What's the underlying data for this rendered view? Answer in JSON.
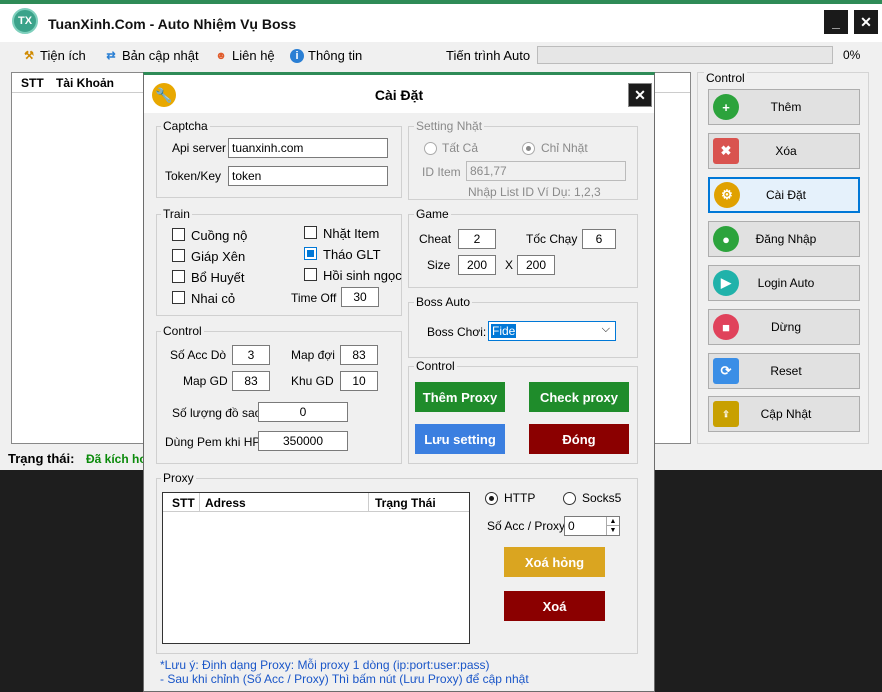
{
  "app": {
    "logo": "TX",
    "title": "TuanXinh.Com - Auto Nhiệm Vụ Boss",
    "minimize": "_",
    "close": "✕"
  },
  "menu": [
    {
      "label": "Tiện ích",
      "icon": "tools-icon"
    },
    {
      "label": "Bản cập nhật",
      "icon": "refresh-icon"
    },
    {
      "label": "Liên hệ",
      "icon": "person-icon"
    },
    {
      "label": "Thông tin",
      "icon": "info-icon"
    }
  ],
  "progress": {
    "label": "Tiến trình Auto",
    "value_text": "0%",
    "fraction": 0
  },
  "accounts": {
    "columns": [
      "STT",
      "Tài Khoản"
    ]
  },
  "status": {
    "label": "Trạng thái:",
    "value": "Đã kích ho"
  },
  "right_panel": {
    "legend": "Control",
    "buttons": [
      {
        "label": "Thêm",
        "icon": "plus-icon",
        "color": "#2ca33c"
      },
      {
        "label": "Xóa",
        "icon": "trash-icon",
        "color": "#d9534f"
      },
      {
        "label": "Cài Đặt",
        "icon": "gear-icon",
        "color": "#e0a100"
      },
      {
        "label": "Đăng Nhập",
        "icon": "login-icon",
        "color": "#2ca33c"
      },
      {
        "label": "Login Auto",
        "icon": "play-icon",
        "color": "#20b2aa"
      },
      {
        "label": "Dừng",
        "icon": "stop-icon",
        "color": "#e0425b"
      },
      {
        "label": "Reset",
        "icon": "reset-icon",
        "color": "#3a8ee6"
      },
      {
        "label": "Cập Nhật",
        "icon": "update-icon",
        "color": "#c8a000"
      }
    ]
  },
  "dialog": {
    "title": "Cài Đặt",
    "close": "✕",
    "captcha": {
      "legend": "Captcha",
      "api_label": "Api server",
      "api_value": "tuanxinh.com",
      "token_label": "Token/Key",
      "token_value": "token"
    },
    "setting_nhat": {
      "legend": "Setting Nhặt",
      "all": "Tất Cả",
      "only": "Chỉ Nhặt",
      "id_label": "ID Item",
      "id_value": "861,77",
      "hint": "Nhập List ID Ví Dụ: 1,2,3"
    },
    "train": {
      "legend": "Train",
      "items": [
        "Cuồng nộ",
        "Giáp Xên",
        "Bổ Huyết",
        "Nhai cỏ"
      ],
      "items_right": [
        "Nhặt Item",
        "Tháo GLT",
        "Hồi sinh ngọc"
      ],
      "timeoff_label": "Time Off",
      "timeoff_value": "30"
    },
    "game": {
      "legend": "Game",
      "cheat_label": "Cheat",
      "cheat_value": "2",
      "speed_label": "Tốc Chạy",
      "speed_value": "6",
      "size_label": "Size",
      "w": "200",
      "x": "X",
      "h": "200"
    },
    "boss": {
      "legend": "Boss Auto",
      "label": "Boss Chơi:",
      "value": "Fide",
      "arrow": "⌵"
    },
    "control": {
      "legend": "Control",
      "acc_label": "Số Acc Dò",
      "acc_value": "3",
      "mapdoi_label": "Map đợi",
      "mapdoi_value": "83",
      "mapgd_label": "Map GD",
      "mapgd_value": "83",
      "khugd_label": "Khu GD",
      "khugd_value": "10",
      "sao_label": "Số lượng đồ sao",
      "sao_value": "0",
      "pem_label": "Dùng Pem khi HP",
      "pem_value": "350000"
    },
    "control2": {
      "legend": "Control",
      "add_proxy": "Thêm Proxy",
      "check_proxy": "Check proxy",
      "save": "Lưu setting",
      "close": "Đóng",
      "colors": {
        "green": "#1f8c2b",
        "blue": "#3b7fe0",
        "red": "#8b0000"
      }
    },
    "proxy": {
      "legend": "Proxy",
      "columns": [
        "STT",
        "Adress",
        "Trạng Thái"
      ],
      "http": "HTTP",
      "socks": "Socks5",
      "acc_label": "Số Acc / Proxy",
      "acc_value": "0",
      "remove_bad": "Xoá hỏng",
      "remove": "Xoá",
      "colors": {
        "gold": "#daa520",
        "red": "#8b0000"
      }
    },
    "notes": [
      "*Lưu ý:  Định dạng Proxy: Mỗi proxy 1 dòng (ip:port:user:pass)",
      "- Sau khi chỉnh (Số Acc / Proxy) Thì bấm nút (Lưu Proxy) để cập nhật"
    ]
  }
}
